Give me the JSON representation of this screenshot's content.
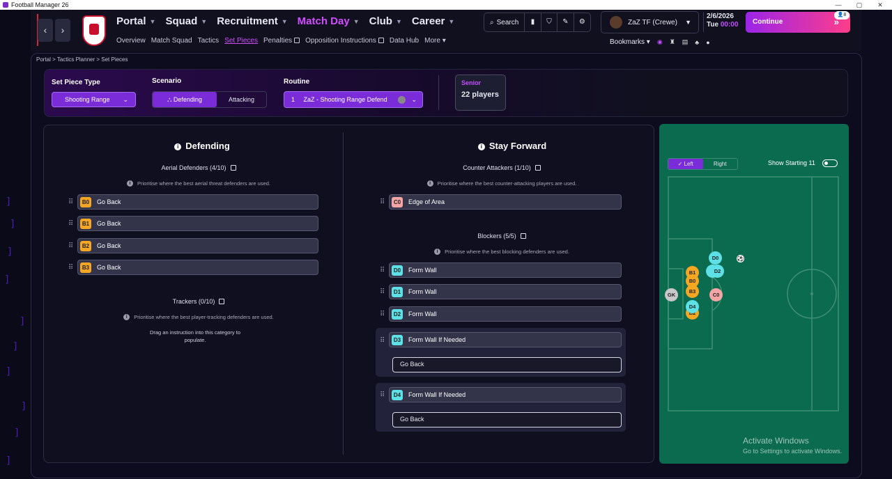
{
  "window": {
    "title": "Football Manager 26",
    "controls": [
      "—",
      "▢",
      "✕"
    ]
  },
  "nav": {
    "back": "‹",
    "forward": "›",
    "main": [
      {
        "label": "Portal"
      },
      {
        "label": "Squad"
      },
      {
        "label": "Recruitment"
      },
      {
        "label": "Match Day"
      },
      {
        "label": "Club"
      },
      {
        "label": "Career"
      }
    ],
    "sub": [
      {
        "label": "Overview"
      },
      {
        "label": "Match Squad"
      },
      {
        "label": "Tactics"
      },
      {
        "label": "Set Pieces"
      },
      {
        "label": "Penalties"
      },
      {
        "label": "Opposition Instructions"
      },
      {
        "label": "Data Hub"
      },
      {
        "label": "More"
      }
    ]
  },
  "toolbar": {
    "search_label": "Search"
  },
  "manager": {
    "name": "ZaZ TF (Crewe)"
  },
  "date": {
    "day_date": "2/6/2026",
    "weekday": "Tue",
    "time": "00:00"
  },
  "continue_label": "Continue",
  "inbox_badge": "8",
  "bookmarks_label": "Bookmarks",
  "breadcrumb": {
    "items": [
      "Portal",
      "Tactics Planner",
      "Set Pieces"
    ]
  },
  "setbar": {
    "type_label": "Set Piece Type",
    "type_value": "Shooting Range",
    "scenario_label": "Scenario",
    "scenario_defending": "Defending",
    "scenario_attacking": "Attacking",
    "routine_label": "Routine",
    "routine_number": "1",
    "routine_value": "ZaZ - Shooting Range Defend",
    "squad_type": "Senior",
    "squad_count": "22 players"
  },
  "left": {
    "title": "Defending",
    "aerial": {
      "title": "Aerial Defenders (4/10)",
      "hint": "Prioritise where the best aerial threat defenders are used.",
      "rows": [
        {
          "tag": "B0",
          "label": "Go Back"
        },
        {
          "tag": "B1",
          "label": "Go Back"
        },
        {
          "tag": "B2",
          "label": "Go Back"
        },
        {
          "tag": "B3",
          "label": "Go Back"
        }
      ]
    },
    "trackers": {
      "title": "Trackers (0/10)",
      "hint": "Prioritise where the best player-tracking defenders are used.",
      "empty": "Drag an instruction into this category to populate."
    }
  },
  "right": {
    "title": "Stay Forward",
    "counter": {
      "title": "Counter Attackers (1/10)",
      "hint": "Prioritise where the best counter-attacking players are used.",
      "rows": [
        {
          "tag": "C0",
          "label": "Edge of Area"
        }
      ]
    },
    "blockers": {
      "title": "Blockers (5/5)",
      "hint": "Prioritise where the best blocking defenders are used.",
      "rows": [
        {
          "tag": "D0",
          "label": "Form Wall"
        },
        {
          "tag": "D1",
          "label": "Form Wall"
        },
        {
          "tag": "D2",
          "label": "Form Wall"
        },
        {
          "tag": "D3",
          "label": "Form Wall If Needed",
          "sub": "Go Back"
        },
        {
          "tag": "D4",
          "label": "Form Wall If Needed",
          "sub": "Go Back"
        }
      ]
    }
  },
  "pitch": {
    "side_left": "Left",
    "side_right": "Right",
    "show_starting": "Show Starting 11",
    "show_starting_on": false,
    "players": [
      "D0",
      "B1",
      "B0",
      "B3",
      "D2",
      "GK",
      "C0",
      "D4",
      "B2"
    ],
    "watermark_title": "Activate Windows",
    "watermark_sub": "Go to Settings to activate Windows."
  },
  "colors": {
    "accent": "#7a2cd8",
    "highlight": "#d24dff",
    "pitch": "#0b6b4e",
    "tag_b": "#f5a623",
    "tag_c": "#f5a5a5",
    "tag_d": "#5de0e6"
  }
}
